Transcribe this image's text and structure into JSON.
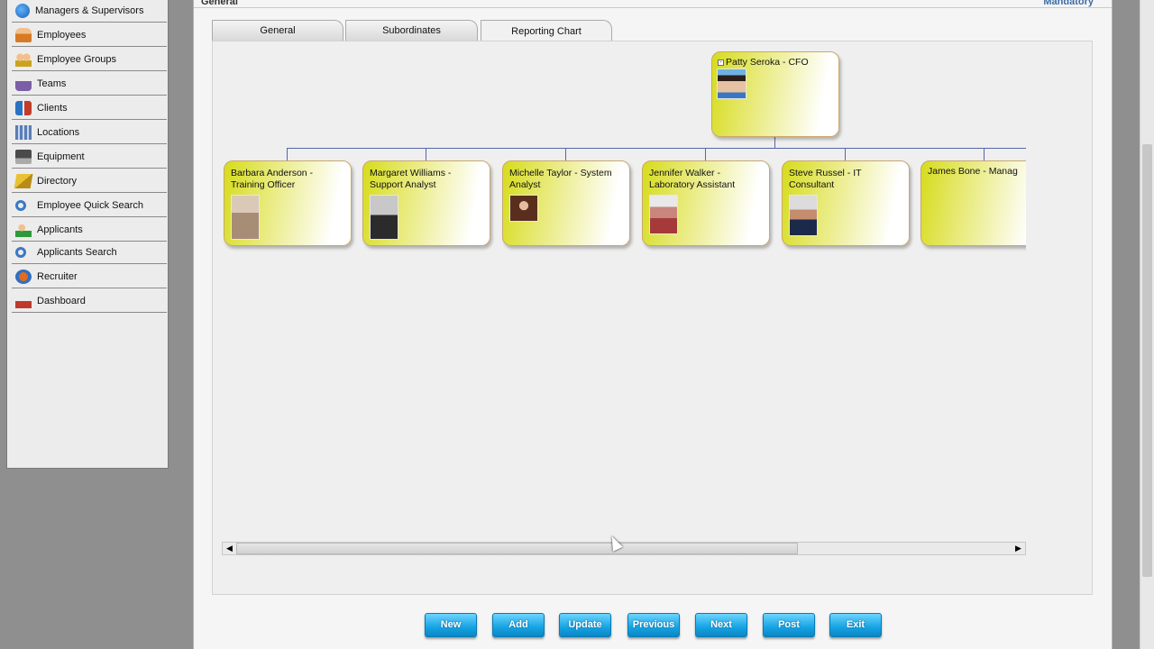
{
  "sidebar": {
    "items": [
      {
        "label": "Managers & Supervisors",
        "icon": "globe-icon"
      },
      {
        "label": "Employees",
        "icon": "person-icon"
      },
      {
        "label": "Employee Groups",
        "icon": "group-icon"
      },
      {
        "label": "Teams",
        "icon": "team-icon"
      },
      {
        "label": "Clients",
        "icon": "clients-icon"
      },
      {
        "label": "Locations",
        "icon": "building-icon"
      },
      {
        "label": "Equipment",
        "icon": "equipment-icon"
      },
      {
        "label": "Directory",
        "icon": "directory-icon"
      },
      {
        "label": "Employee Quick Search",
        "icon": "search-icon"
      },
      {
        "label": "Applicants",
        "icon": "applicants-icon"
      },
      {
        "label": "Applicants Search",
        "icon": "search-icon"
      },
      {
        "label": "Recruiter",
        "icon": "recruiter-icon"
      },
      {
        "label": "Dashboard",
        "icon": "dashboard-icon"
      }
    ]
  },
  "header": {
    "section_title": "General",
    "mandatory_label": "Mandatory"
  },
  "tabs": [
    {
      "label": "General"
    },
    {
      "label": "Subordinates"
    },
    {
      "label": "Reporting Chart",
      "active": true
    }
  ],
  "org_chart": {
    "root": {
      "title": "Patty Seroka - CFO",
      "collapse_symbol": "-"
    },
    "children": [
      {
        "title": "Barbara Anderson - Training Officer"
      },
      {
        "title": "Margaret Williams - Support Analyst"
      },
      {
        "title": "Michelle Taylor - System Analyst"
      },
      {
        "title": "Jennifer Walker - Laboratory Assistant"
      },
      {
        "title": "Steve Russel - IT Consultant"
      },
      {
        "title": "James Bone - Manag"
      }
    ]
  },
  "scrollbar": {
    "left_arrow": "◀",
    "right_arrow": "▶"
  },
  "buttons": {
    "new": "New",
    "add": "Add",
    "update": "Update",
    "previous": "Previous",
    "next": "Next",
    "post": "Post",
    "exit": "Exit"
  },
  "colors": {
    "accent_button": "#16a3e3",
    "node_fill": "#d6dc1c",
    "connector": "#5566aa",
    "link": "#3d6da5"
  }
}
